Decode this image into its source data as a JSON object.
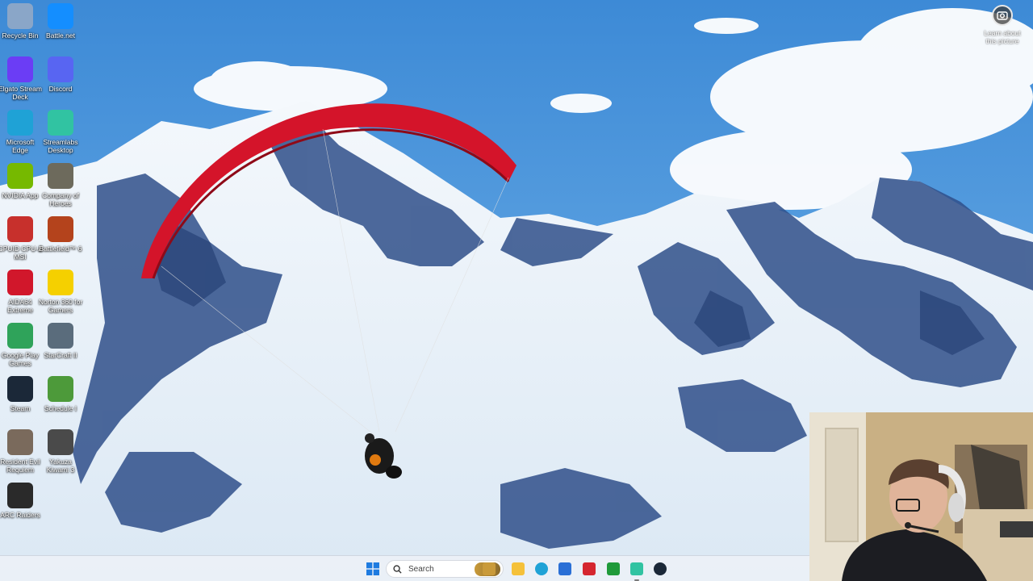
{
  "desktop": {
    "icons": [
      {
        "label": "Recycle Bin",
        "icon": "recycle-bin-icon",
        "color": "#8aa6c8"
      },
      {
        "label": "Battle.net",
        "icon": "battlenet-icon",
        "color": "#148eff"
      },
      {
        "label": "Elgato Stream Deck",
        "icon": "stream-deck-icon",
        "color": "#6b3df5"
      },
      {
        "label": "Discord",
        "icon": "discord-icon",
        "color": "#5865f2"
      },
      {
        "label": "Microsoft Edge",
        "icon": "edge-icon",
        "color": "#1fa2d6"
      },
      {
        "label": "Streamlabs Desktop",
        "icon": "streamlabs-icon",
        "color": "#31c3a2"
      },
      {
        "label": "NVIDIA App",
        "icon": "nvidia-icon",
        "color": "#76b900"
      },
      {
        "label": "Company of Heroes",
        "icon": "company-of-heroes-icon",
        "color": "#6d6a5c"
      },
      {
        "label": "CPUID CPU-Z MSI",
        "icon": "cpuz-icon",
        "color": "#c7302c"
      },
      {
        "label": "Battlefield™ 6",
        "icon": "battlefield-icon",
        "color": "#b4431c"
      },
      {
        "label": "AIDA64 Extreme",
        "icon": "aida64-icon",
        "color": "#d1172b"
      },
      {
        "label": "Norton 360 for Gamers",
        "icon": "norton-icon",
        "color": "#f5d000"
      },
      {
        "label": "Google Play Games",
        "icon": "google-play-games-icon",
        "color": "#2fa35a"
      },
      {
        "label": "StarCraft II",
        "icon": "starcraft-icon",
        "color": "#5a6c7c"
      },
      {
        "label": "Steam",
        "icon": "steam-icon",
        "color": "#1b2838"
      },
      {
        "label": "Schedule I",
        "icon": "schedule-icon",
        "color": "#4d9a3a"
      },
      {
        "label": "Resident Evil Requiem",
        "icon": "resident-evil-icon",
        "color": "#7a6a5c"
      },
      {
        "label": "Yakuza Kiwami 3",
        "icon": "yakuza-icon",
        "color": "#4a4a4a"
      },
      {
        "label": "ARC Raiders",
        "icon": "arc-raiders-icon",
        "color": "#2a2a2a"
      }
    ],
    "learn_picture_label": "Learn about this picture"
  },
  "taskbar": {
    "search_placeholder": "Search",
    "buttons": [
      {
        "icon": "windows-start-icon",
        "color": "#1e7be0"
      },
      {
        "icon": "widgets-icon",
        "color": "#c99a3a"
      },
      {
        "icon": "file-explorer-icon",
        "color": "#f5c13a"
      },
      {
        "icon": "edge-icon",
        "color": "#1fa2d6"
      },
      {
        "icon": "store-icon",
        "color": "#2a6fd6"
      },
      {
        "icon": "red-app-icon",
        "color": "#d5262f"
      },
      {
        "icon": "xbox-icon",
        "color": "#1f9a3a"
      },
      {
        "icon": "streamlabs-icon",
        "color": "#31c3a2"
      },
      {
        "icon": "steam-icon",
        "color": "#1b2838"
      }
    ]
  }
}
